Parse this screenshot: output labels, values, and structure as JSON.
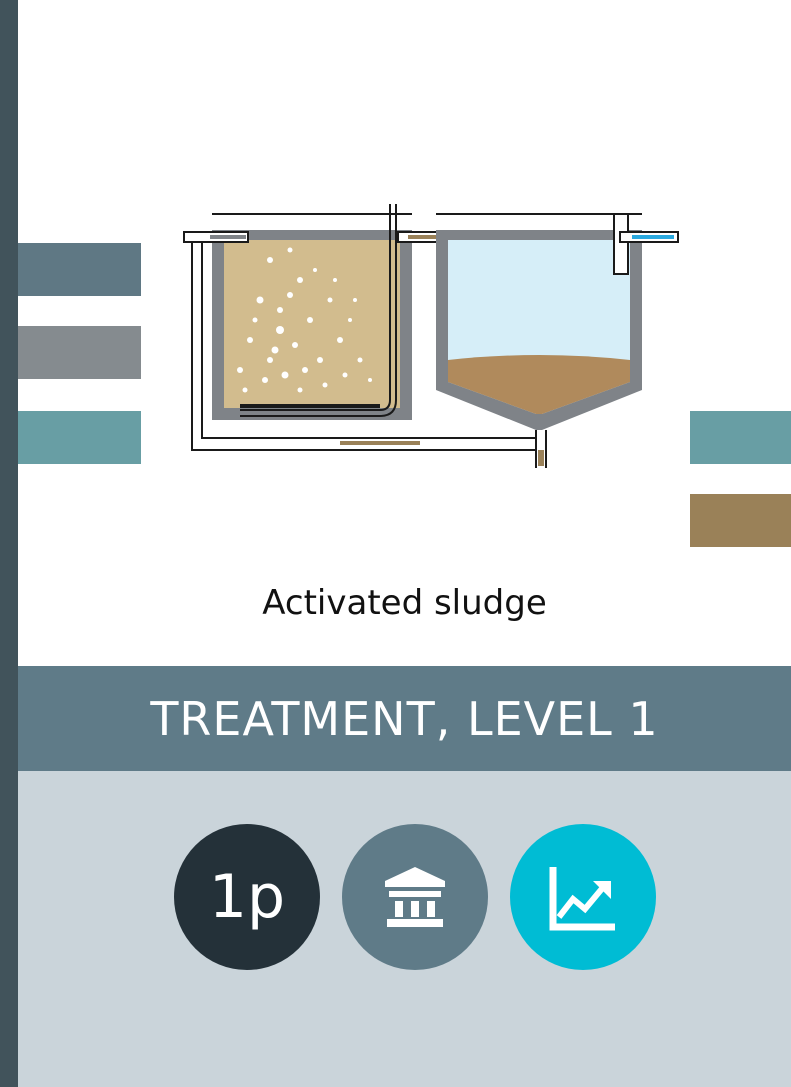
{
  "caption": "Activated sludge",
  "band": {
    "title": "TREATMENT, LEVEL 1"
  },
  "badges": [
    {
      "label": "1p",
      "icon": "",
      "color": "#243139"
    },
    {
      "label": "",
      "icon": "institution-icon",
      "color": "#5f7b88"
    },
    {
      "label": "",
      "icon": "trend-chart-icon",
      "color": "#00bcd4"
    }
  ],
  "colors": {
    "rail": "#41535b",
    "band": "#5f7b88",
    "lower_panel": "#cad4da",
    "stripe_slate": "#5f7884",
    "stripe_gray": "#858b8f",
    "stripe_teal": "#689ea4",
    "stripe_brown": "#9a8158",
    "sludge": "#d2bc8e",
    "clear_water": "#d6eef8"
  }
}
